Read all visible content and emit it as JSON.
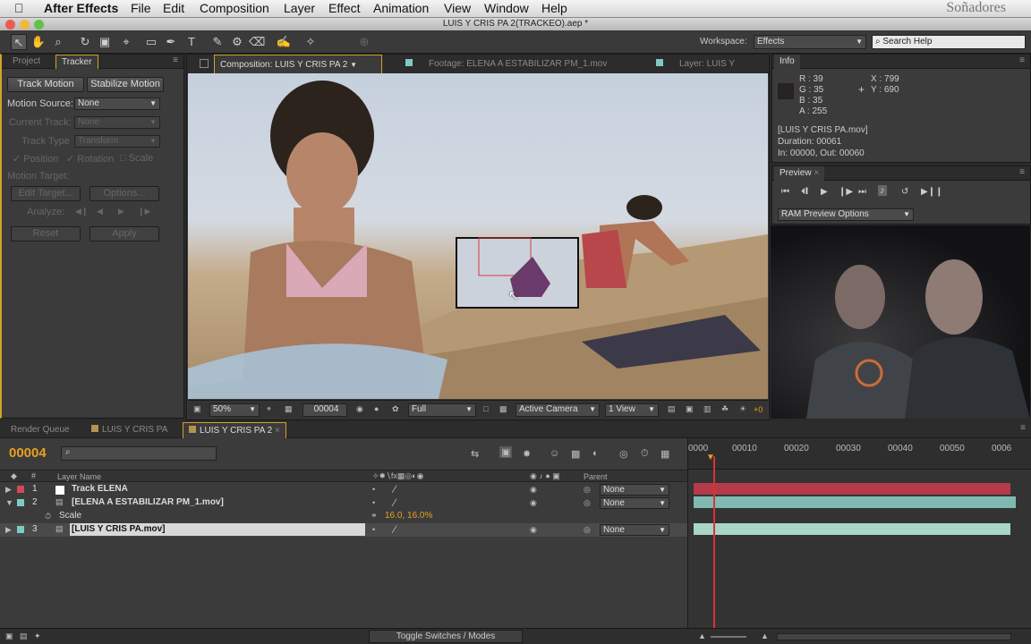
{
  "menubar": {
    "app": "After Effects",
    "items": [
      "File",
      "Edit",
      "Composition",
      "Layer",
      "Effect",
      "Animation",
      "View",
      "Window",
      "Help"
    ],
    "brand": "Soñadores"
  },
  "window": {
    "title": "LUIS Y CRIS PA 2(TRACKEO).aep *"
  },
  "workspace": {
    "label": "Workspace:",
    "value": "Effects",
    "search": "Search Help"
  },
  "left_panel": {
    "tabs": [
      "Project",
      "Tracker"
    ],
    "track_motion": "Track Motion",
    "stabilize_motion": "Stabilize Motion",
    "motion_source_label": "Motion Source:",
    "motion_source_value": "None",
    "current_track_label": "Current Track:",
    "current_track_value": "None",
    "track_type_label": "Track Type",
    "track_type_value": "Transform",
    "position": "Position",
    "rotation": "Rotation",
    "scale": "Scale",
    "motion_target": "Motion Target:",
    "edit_target": "Edit Target...",
    "options": "Options...",
    "analyze": "Analyze:",
    "reset": "Reset",
    "apply": "Apply"
  },
  "viewer": {
    "tab_comp": "Composition: LUIS Y CRIS PA 2",
    "tab_footage": "Footage: ELENA A ESTABILIZAR PM_1.mov",
    "tab_layer": "Layer: LUIS Y",
    "zoom": "50%",
    "timecode": "00004",
    "resolution": "Full",
    "camera": "Active Camera",
    "view": "1 View",
    "exposure": "+0"
  },
  "info": {
    "tab": "Info",
    "r": "R : 39",
    "g": "G : 35",
    "b": "B : 35",
    "a": "A : 255",
    "x": "X : 799",
    "y": "Y : 690",
    "file": "[LUIS Y CRIS PA.mov]",
    "duration": "Duration: 00061",
    "inout": "In: 00000, Out: 00060"
  },
  "preview": {
    "tab": "Preview",
    "ram": "RAM Preview Options"
  },
  "timeline": {
    "tabs": [
      "Render Queue",
      "LUIS Y CRIS PA",
      "LUIS Y CRIS PA 2"
    ],
    "current_time": "00004",
    "layer_name_header": "Layer Name",
    "parent_header": "Parent",
    "layers": [
      {
        "num": "1",
        "name": "Track ELENA",
        "parent": "None",
        "color": "#ffffff"
      },
      {
        "num": "2",
        "name": "[ELENA A ESTABILIZAR PM_1.mov]",
        "parent": "None",
        "color": "#7fcac4"
      },
      {
        "num": "3",
        "name": "[LUIS Y CRIS PA.mov]",
        "parent": "None",
        "color": "#7fcac4"
      }
    ],
    "scale_label": "Scale",
    "scale_value": "16.0, 16.0%",
    "ruler": [
      "0000",
      "00010",
      "00020",
      "00030",
      "00040",
      "00050",
      "0006"
    ],
    "toggle": "Toggle Switches / Modes",
    "layer_bar_colors": [
      "#b33b4a",
      "#7fb9b2",
      "#a9d4c8"
    ]
  },
  "colors": {
    "accent": "#e8a020",
    "panel": "#3b3b3b",
    "playhead": "#e03030"
  }
}
